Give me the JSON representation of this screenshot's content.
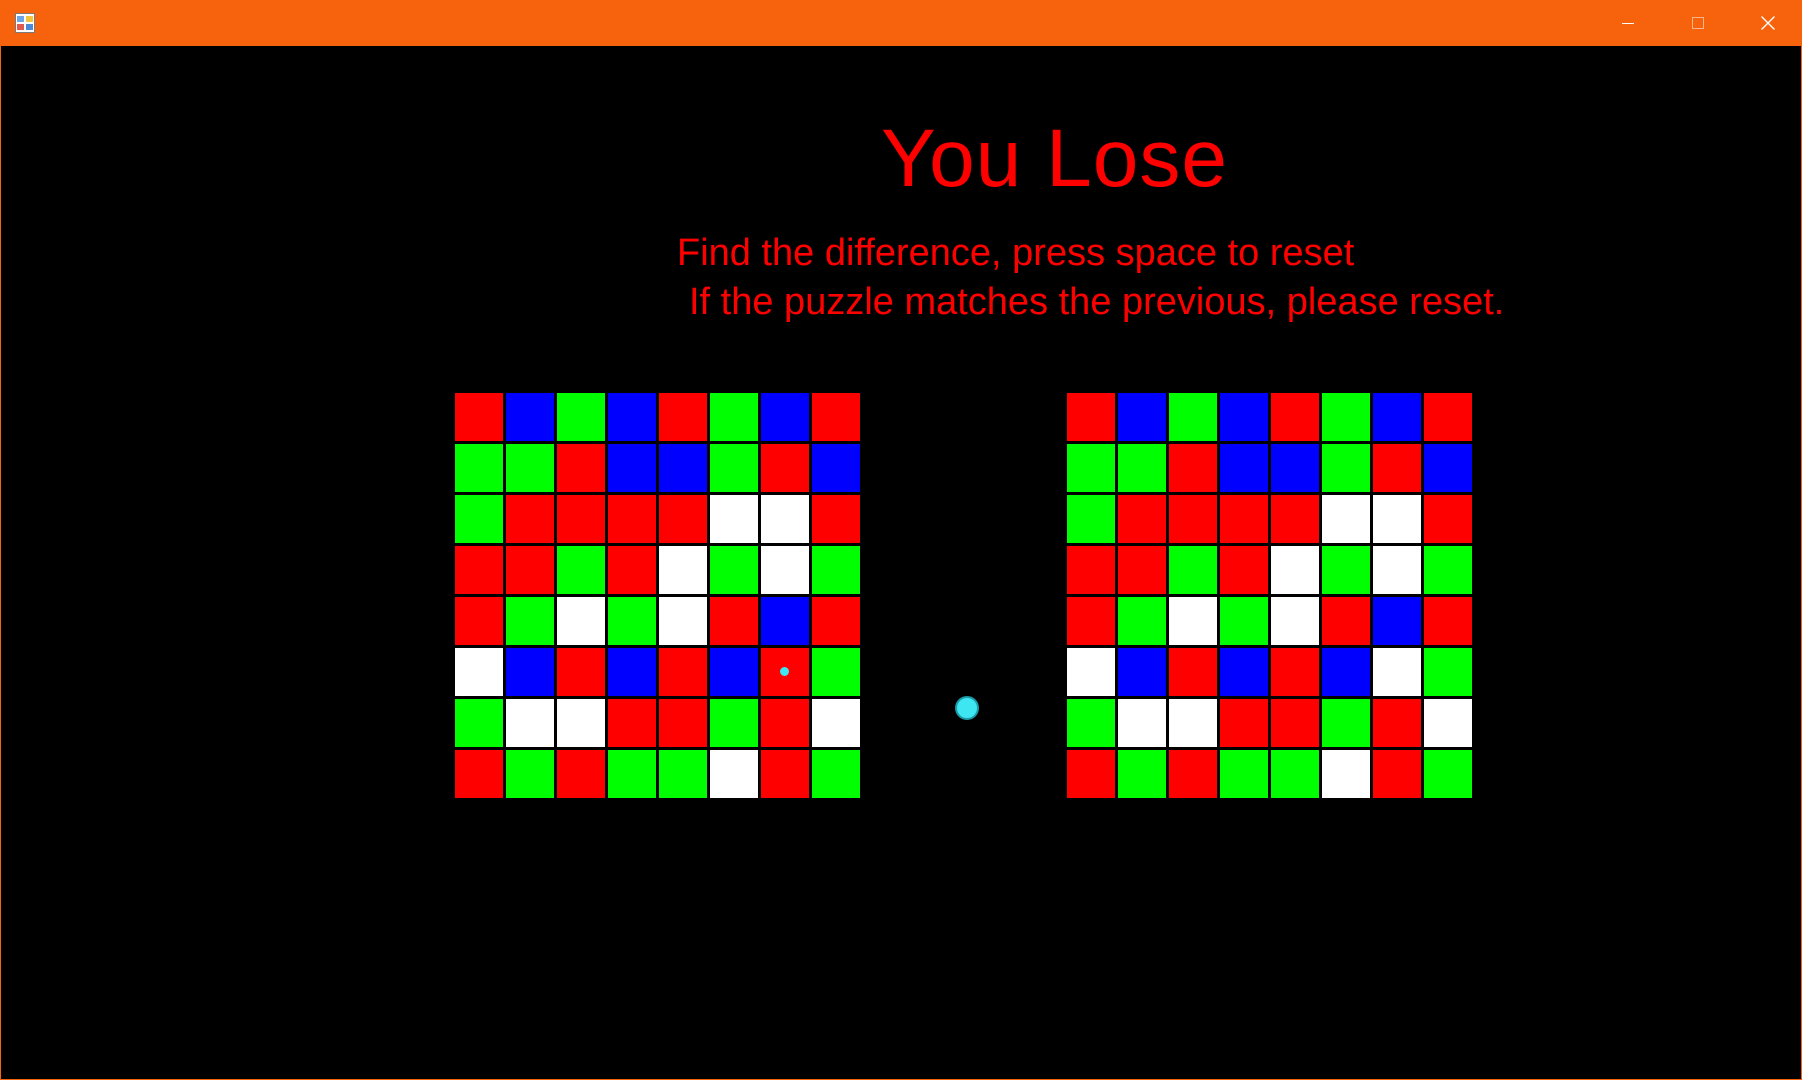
{
  "window": {
    "titlebar_color": "#f7630c",
    "background_color": "#000000",
    "icon": "app-icon",
    "controls": [
      "minimize-icon",
      "maximize-icon",
      "close-icon"
    ]
  },
  "game": {
    "title": "You Lose",
    "instruction_line_1": "Find the difference, press space to reset",
    "instruction_line_2": "If the puzzle matches the previous, please reset.",
    "text_color": "#ff0000",
    "colors": {
      "R": "#ff0000",
      "G": "#00ff00",
      "B": "#0000ff",
      "W": "#ffffff"
    },
    "marker_color": "#3ee6f2",
    "left_grid": [
      [
        "R",
        "B",
        "G",
        "B",
        "R",
        "G",
        "B",
        "R"
      ],
      [
        "G",
        "G",
        "R",
        "B",
        "B",
        "G",
        "R",
        "B"
      ],
      [
        "G",
        "R",
        "R",
        "R",
        "R",
        "W",
        "W",
        "R"
      ],
      [
        "R",
        "R",
        "G",
        "R",
        "W",
        "G",
        "W",
        "G"
      ],
      [
        "R",
        "G",
        "W",
        "G",
        "W",
        "R",
        "B",
        "R"
      ],
      [
        "W",
        "B",
        "R",
        "B",
        "R",
        "B",
        "R",
        "G"
      ],
      [
        "G",
        "W",
        "W",
        "R",
        "R",
        "G",
        "R",
        "W"
      ],
      [
        "R",
        "G",
        "R",
        "G",
        "G",
        "W",
        "R",
        "G"
      ]
    ],
    "right_grid": [
      [
        "R",
        "B",
        "G",
        "B",
        "R",
        "G",
        "B",
        "R"
      ],
      [
        "G",
        "G",
        "R",
        "B",
        "B",
        "G",
        "R",
        "B"
      ],
      [
        "G",
        "R",
        "R",
        "R",
        "R",
        "W",
        "W",
        "R"
      ],
      [
        "R",
        "R",
        "G",
        "R",
        "W",
        "G",
        "W",
        "G"
      ],
      [
        "R",
        "G",
        "W",
        "G",
        "W",
        "R",
        "B",
        "R"
      ],
      [
        "W",
        "B",
        "R",
        "B",
        "R",
        "B",
        "W",
        "G"
      ],
      [
        "G",
        "W",
        "W",
        "R",
        "R",
        "G",
        "R",
        "W"
      ],
      [
        "R",
        "G",
        "R",
        "G",
        "G",
        "W",
        "R",
        "G"
      ]
    ],
    "selected_cell": {
      "grid": "left",
      "row": 5,
      "col": 6
    }
  }
}
